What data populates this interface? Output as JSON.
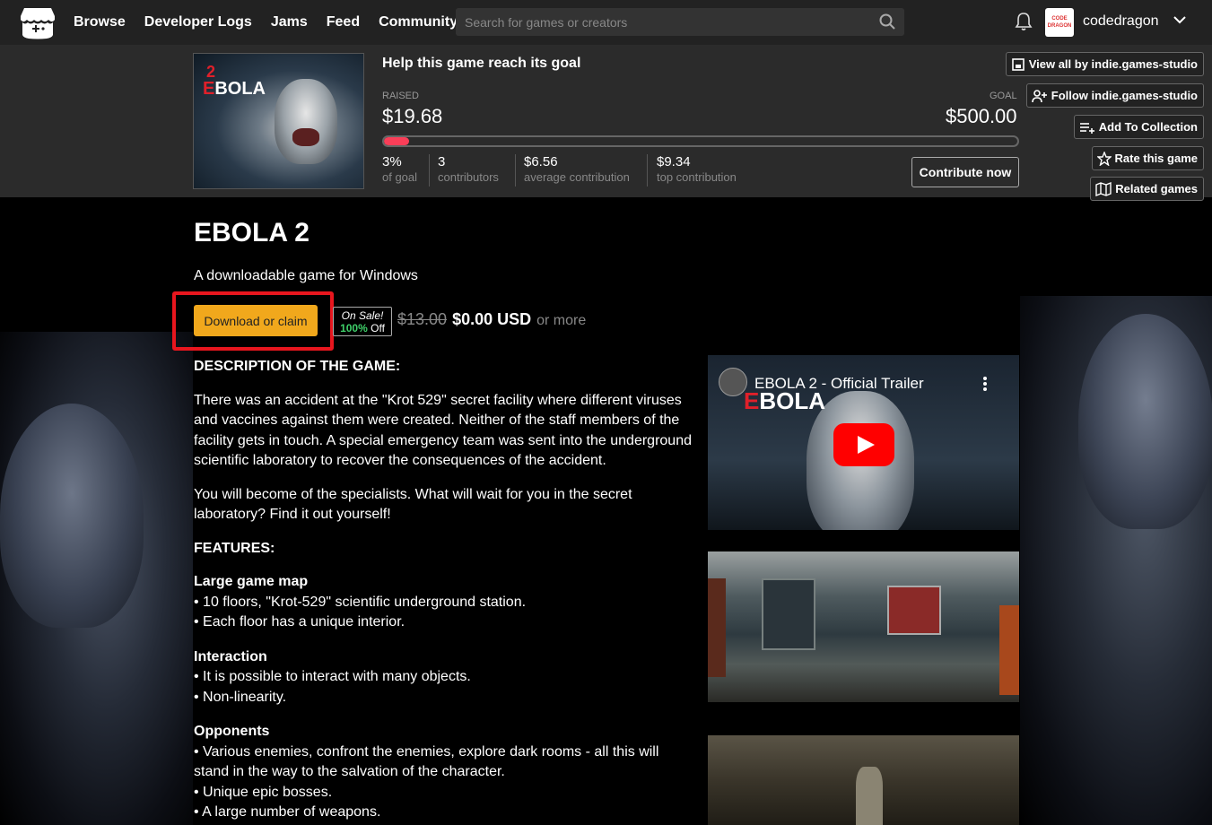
{
  "nav": {
    "logo_icon": "itch-logo-icon",
    "links": [
      "Browse",
      "Developer Logs",
      "Jams",
      "Feed",
      "Community"
    ],
    "search_placeholder": "Search for games or creators",
    "username": "codedragon",
    "avatar_text": "CODE DRAGON"
  },
  "goal": {
    "heading": "Help this game reach its goal",
    "raised_label": "RAISED",
    "raised_value": "$19.68",
    "goal_label": "GOAL",
    "goal_value": "$500.00",
    "progress_fraction": 0.04,
    "stats": [
      {
        "value": "3%",
        "label": "of goal"
      },
      {
        "value": "3",
        "label": "contributors"
      },
      {
        "value": "$6.56",
        "label": "average contribution"
      },
      {
        "value": "$9.34",
        "label": "top contribution"
      }
    ],
    "contribute_label": "Contribute now",
    "progress_color": "#fa3e58"
  },
  "cover": {
    "num": "2",
    "title_first": "E",
    "title_rest": "BOLA"
  },
  "side_buttons": [
    {
      "label": "View all by indie.games-studio",
      "icon": "itch-store-icon"
    },
    {
      "label": "Follow indie.games-studio",
      "icon": "user-plus-icon"
    },
    {
      "label": "Add To Collection",
      "icon": "list-add-icon"
    },
    {
      "label": "Rate this game",
      "icon": "star-icon"
    },
    {
      "label": "Related games",
      "icon": "map-icon"
    }
  ],
  "game": {
    "title": "EBOLA 2",
    "subtitle": "A downloadable game for Windows",
    "download_label": "Download or claim",
    "sale_line1": "On Sale!",
    "sale_pct": "100%",
    "sale_off": "Off",
    "old_price": "$13.00",
    "new_price": "$0.00 USD",
    "or_more": "or more",
    "accent_color": "#f1a81c",
    "highlight_color": "#e8161e"
  },
  "description": {
    "heading1": "DESCRIPTION OF THE GAME:",
    "para1": "There was an accident at the \"Krot 529\" secret facility where different viruses and vaccines against them were created. Neither of the staff members of the facility gets in touch. A special emergency team was sent into the underground scientific laboratory to recover the consequences of the accident.",
    "para2": "You will become of the specialists. What will wait for you in the secret laboratory? Find it out yourself!",
    "heading2": "FEATURES:",
    "sections": [
      {
        "title": "Large game map",
        "items": [
          "• 10 floors, \"Krot-529\" scientific underground station.",
          "• Each floor has a unique interior."
        ]
      },
      {
        "title": "Interaction",
        "items": [
          "• It is possible to interact with many objects.",
          "• Non-linearity."
        ]
      },
      {
        "title": "Opponents",
        "items": [
          "• Various enemies, confront the enemies, explore dark rooms - all this will stand in the way to the salvation of the character.",
          "• Unique epic bosses.",
          "• A large number of weapons."
        ]
      }
    ]
  },
  "video": {
    "title": "EBOLA 2 - Official Trailer",
    "logo_first": "E",
    "logo_rest": "BOLA"
  }
}
